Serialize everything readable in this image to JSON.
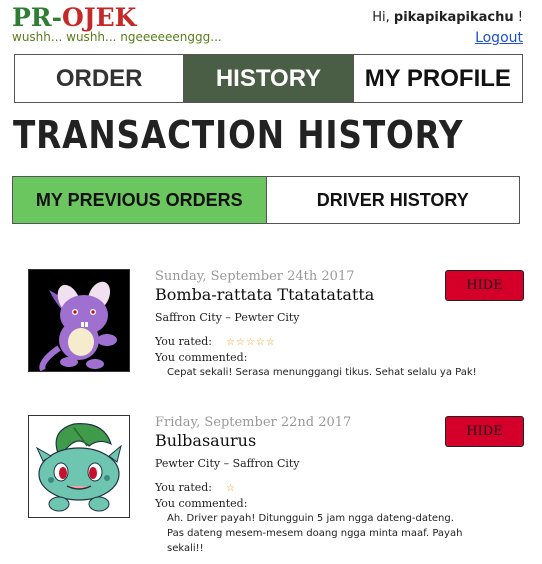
{
  "header": {
    "logo_pr": "PR",
    "logo_dash": "-",
    "logo_ojek": "OJEK",
    "tagline": "wushh... wushh... ngeeeeeenggg...",
    "greeting": "Hi, ",
    "username": "pikapikapikachu",
    "greeting_suffix": " !",
    "logout_label": "Logout"
  },
  "nav": {
    "tabs": [
      {
        "label": "ORDER"
      },
      {
        "label": "HISTORY"
      },
      {
        "label": "MY PROFILE"
      }
    ],
    "active_index": 1
  },
  "page_title": "TRANSACTION HISTORY",
  "sub_nav": {
    "tabs": [
      {
        "label": "MY PREVIOUS ORDERS"
      },
      {
        "label": "DRIVER HISTORY"
      }
    ],
    "active_index": 0
  },
  "orders": [
    {
      "date": "Sunday, September 24th 2017",
      "driver": "Bomba-rattata Ttatatatatta",
      "route": "Saffron City – Pewter City",
      "rated_label": "You rated:",
      "stars": "☆☆☆☆☆",
      "rating": 5,
      "comment_label": "You commented:",
      "comment_lines": [
        "Cepat sekali! Serasa menunggangi tikus. Sehat selalu ya Pak!"
      ],
      "hide_label": "HIDE",
      "avatar": "rattata-avatar"
    },
    {
      "date": "Friday, September 22nd 2017",
      "driver": "Bulbasaurus",
      "route": "Pewter City  – Saffron City",
      "rated_label": "You rated:",
      "stars": "☆",
      "rating": 1,
      "comment_label": "You commented:",
      "comment_lines": [
        "Ah. Driver payah! Ditungguin 5 jam ngga dateng-dateng.",
        "Pas dateng mesem-mesem doang ngga minta maaf. Payah sekali!!"
      ],
      "hide_label": "HIDE",
      "avatar": "bulbasaur-avatar"
    }
  ],
  "colors": {
    "nav_active": "#4a5d45",
    "subnav_active": "#6cc65f",
    "hide_button": "#d4002a",
    "star": "#f0a020",
    "logout_link": "#1a4fd6"
  }
}
